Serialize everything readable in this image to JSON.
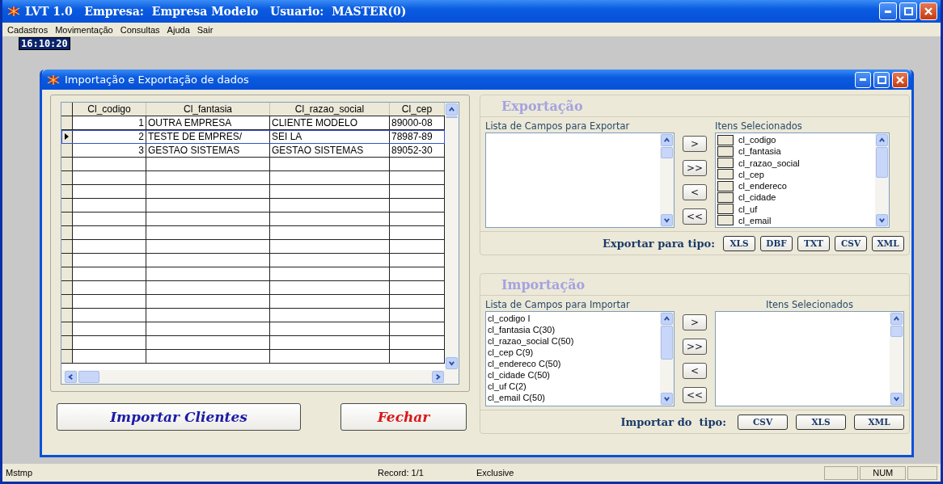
{
  "app_window": {
    "title": "LVT 1.0   Empresa:  Empresa Modelo   Usuario:  MASTER(0)"
  },
  "menu": [
    "Cadastros",
    "Movimentação",
    "Consultas",
    "Ajuda",
    "Sair"
  ],
  "clock": "16:10:20",
  "dialog": {
    "title": "Importação e Exportação de dados",
    "grid": {
      "columns": [
        "Cl_codigo",
        "Cl_fantasia",
        "Cl_razao_social",
        "Cl_cep"
      ],
      "rows": [
        {
          "cells": [
            "1",
            "OUTRA EMPRESA",
            "CLIENTE MODELO",
            "89000-08"
          ],
          "selected": false
        },
        {
          "cells": [
            "2",
            "TESTE DE EMPRES/",
            "SEI LA",
            "78987-89"
          ],
          "selected": true
        },
        {
          "cells": [
            "3",
            "GESTAO SISTEMAS",
            "GESTAO SISTEMAS",
            "89052-30"
          ],
          "selected": false
        }
      ]
    },
    "buttons": [
      {
        "label": "Importar Clientes",
        "kind": "primary"
      },
      {
        "label": "Fechar",
        "kind": "danger"
      }
    ],
    "export": {
      "title": "Exportação",
      "source_label": "Lista de Campos para Exportar",
      "move_buttons": [
        ">",
        ">>",
        "<",
        "<<"
      ],
      "selected_label": "Itens Selecionados",
      "selected_items": [
        {
          "label": "cl_codigo",
          "checked": false
        },
        {
          "label": "cl_fantasia",
          "checked": false
        },
        {
          "label": "cl_razao_social",
          "checked": false
        },
        {
          "label": "cl_cep",
          "checked": false
        },
        {
          "label": "cl_endereco",
          "checked": false
        },
        {
          "label": "cl_cidade",
          "checked": false
        },
        {
          "label": "cl_uf",
          "checked": false
        },
        {
          "label": "cl_email",
          "checked": false
        }
      ],
      "format_label": "Exportar para tipo:",
      "formats": [
        "XLS",
        "DBF",
        "TXT",
        "CSV",
        "XML"
      ]
    },
    "import": {
      "title": "Importação",
      "source_label": "Lista de Campos para Importar",
      "source_items": [
        "cl_codigo I",
        "cl_fantasia C(30)",
        "cl_razao_social C(50)",
        "cl_cep C(9)",
        "cl_endereco C(50)",
        "cl_cidade C(50)",
        "cl_uf C(2)",
        "cl_email C(50)"
      ],
      "move_buttons": [
        ">",
        ">>",
        "<",
        "<<"
      ],
      "selected_label": "Itens Selecionados",
      "format_label": "Importar do  tipo:",
      "formats": [
        "CSV",
        "XLS",
        "XML"
      ]
    }
  },
  "status_bar": [
    "Mstmp",
    "Record: 1/1",
    "Exclusive",
    "NUM"
  ]
}
